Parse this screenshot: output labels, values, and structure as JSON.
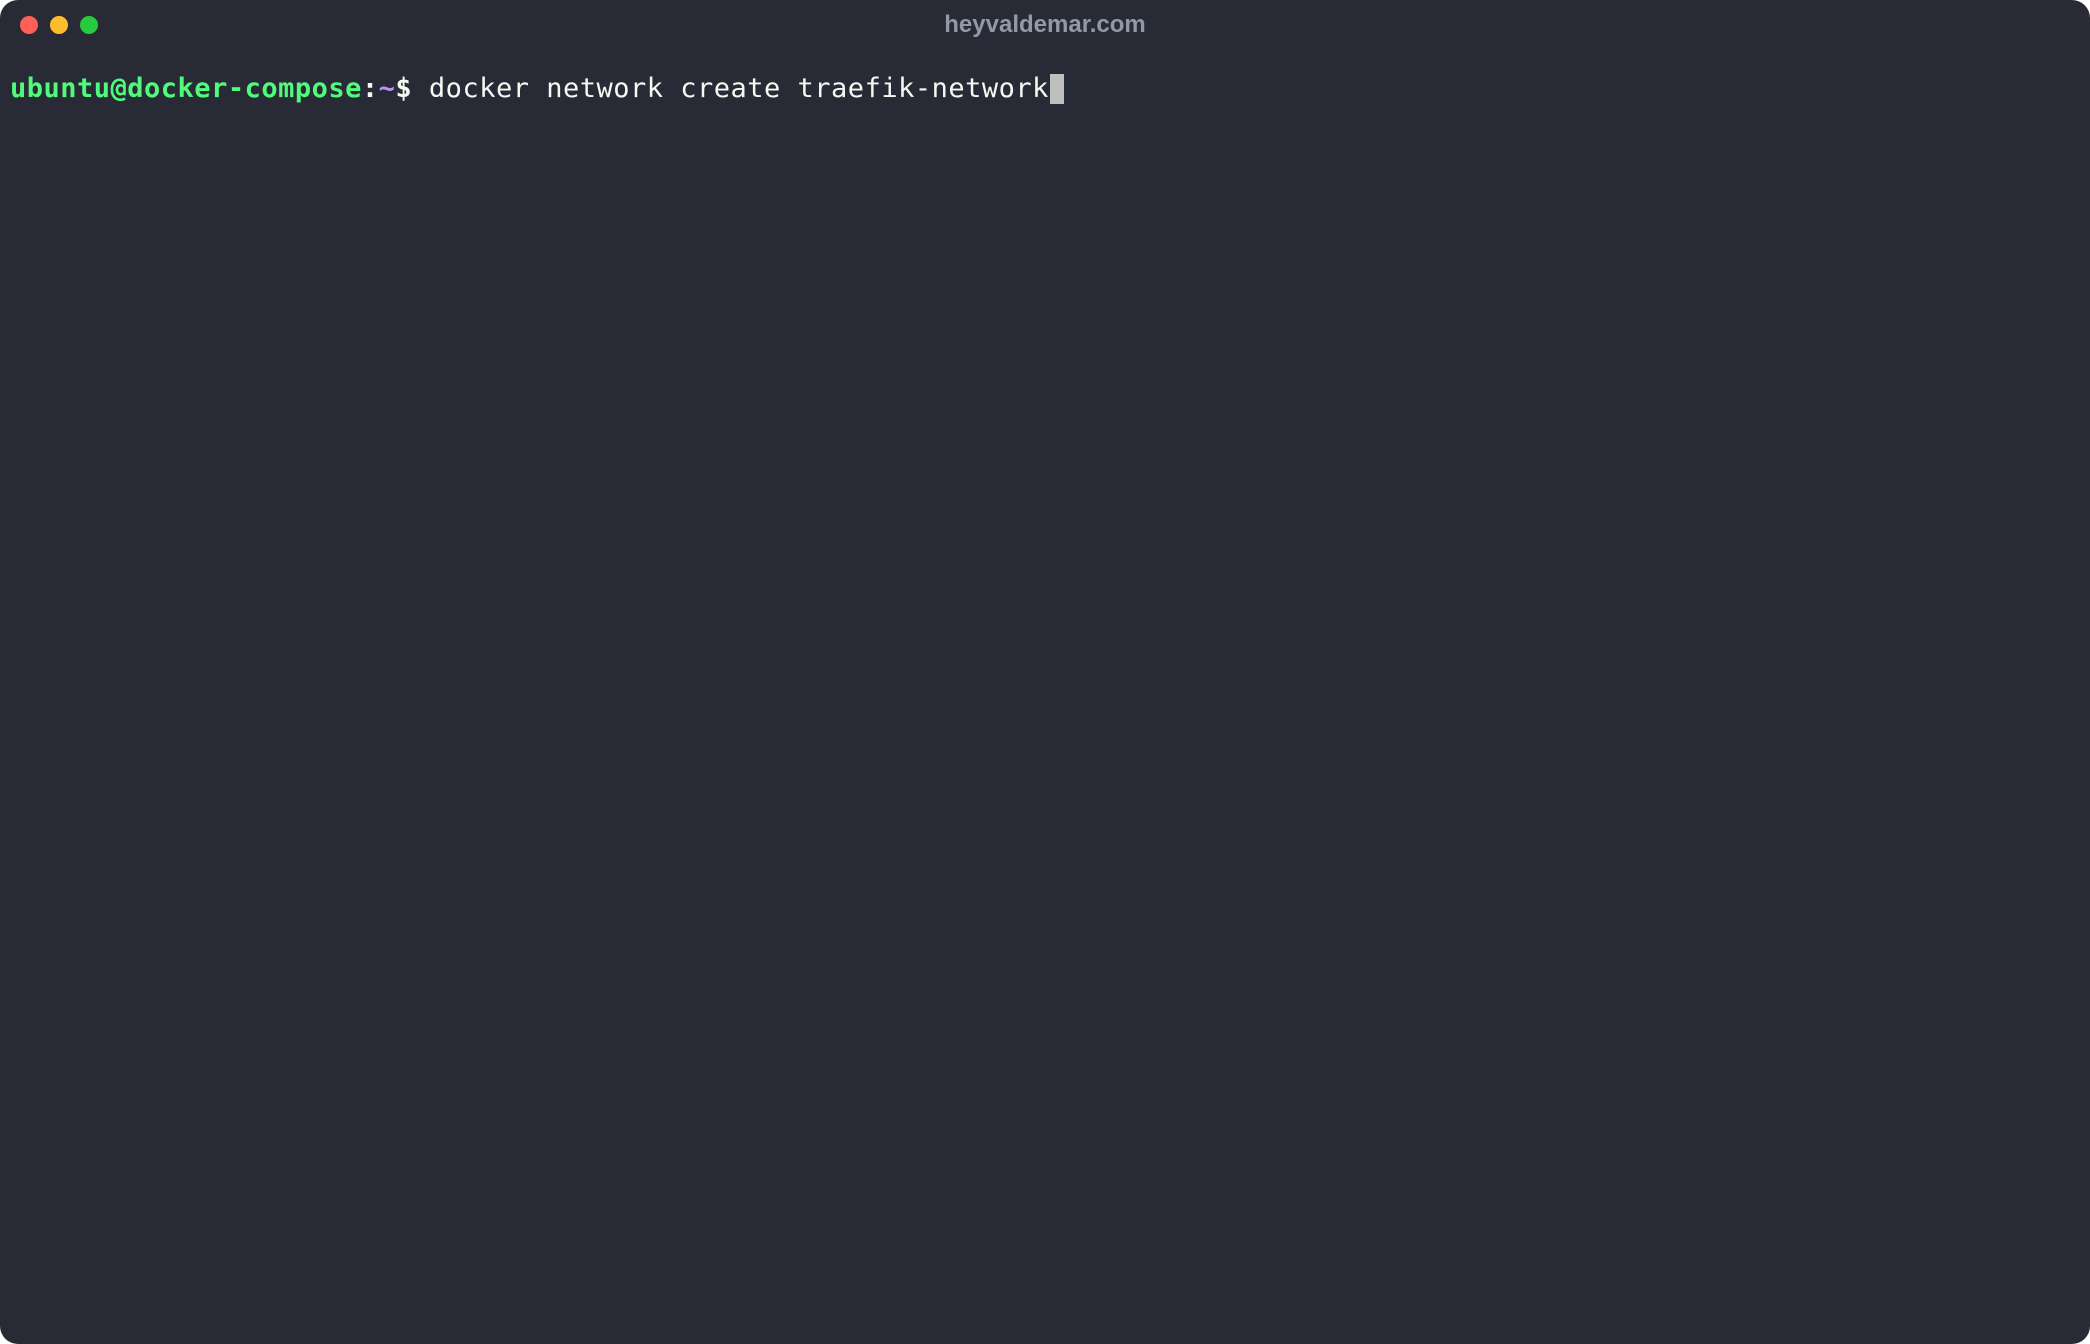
{
  "window": {
    "title": "heyvaldemar.com"
  },
  "prompt": {
    "user_host": "ubuntu@docker-compose",
    "separator": ":",
    "path": "~",
    "symbol": "$"
  },
  "command": " docker network create traefik-network",
  "colors": {
    "background": "#282a36",
    "user_host": "#50fa7b",
    "path": "#bd93f9",
    "text": "#f8f8f2",
    "close": "#ff5f56",
    "minimize": "#ffbd2e",
    "maximize": "#27c93f"
  }
}
